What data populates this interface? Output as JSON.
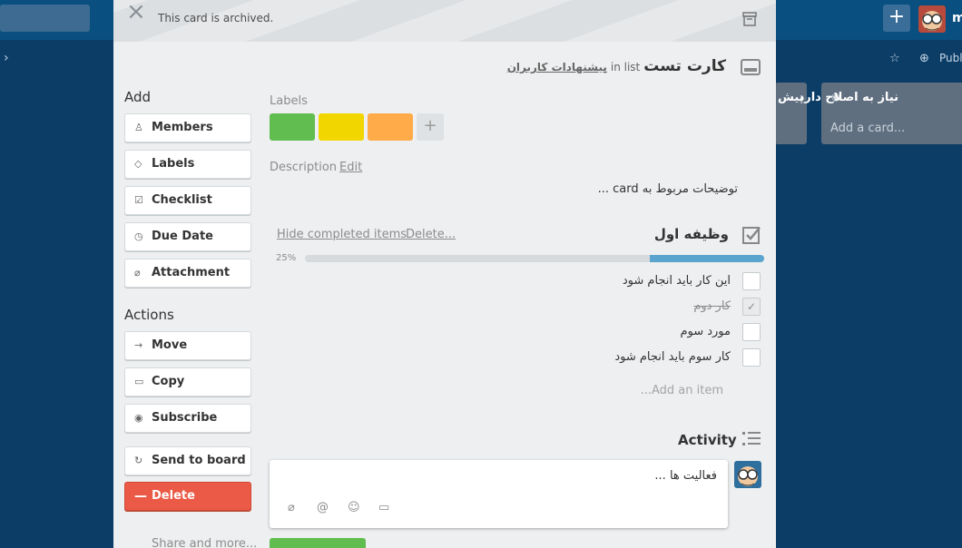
{
  "topbar": {
    "plus_label": "+",
    "user_initial": "m"
  },
  "board": {
    "public_label": "Publ"
  },
  "lists": [
    {
      "title": "پیش"
    },
    {
      "title": "نیاز به اصلاح دارد",
      "add_card": "Add a card..."
    }
  ],
  "archived": {
    "text": "This card is archived."
  },
  "card": {
    "title": "کارت تست",
    "in_list": "in list",
    "list_name": "پیشنهادات کاربران"
  },
  "sidebar": {
    "add_heading": "Add",
    "add_items": [
      {
        "label": "Members",
        "icon": "person-icon"
      },
      {
        "label": "Labels",
        "icon": "tag-icon"
      },
      {
        "label": "Checklist",
        "icon": "checkbox-icon"
      },
      {
        "label": "Due Date",
        "icon": "clock-icon"
      },
      {
        "label": "Attachment",
        "icon": "paperclip-icon"
      }
    ],
    "actions_heading": "Actions",
    "action_items": [
      {
        "label": "Move",
        "icon": "arrow-right-icon"
      },
      {
        "label": "Copy",
        "icon": "card-icon"
      },
      {
        "label": "Subscribe",
        "icon": "eye-icon"
      }
    ],
    "send_to_board": "Send to board",
    "delete": "Delete",
    "share_more": "Share and more..."
  },
  "labels": {
    "heading": "Labels",
    "colors": [
      "#61bd4f",
      "#f2d600",
      "#ffab4a"
    ],
    "add_symbol": "+"
  },
  "description": {
    "heading": "Description",
    "edit": "Edit",
    "text": "توضیحات مربوط به card ..."
  },
  "checklist": {
    "title": "وظیفه اول",
    "hide_completed": "Hide completed items",
    "delete": "Delete...",
    "progress_percent": 25,
    "progress_label": "25%",
    "items": [
      {
        "text": "این کار باید انجام شود",
        "checked": false
      },
      {
        "text": "کار دوم",
        "checked": true
      },
      {
        "text": "مورد سوم",
        "checked": false
      },
      {
        "text": "کار سوم باید انجام شود",
        "checked": false
      }
    ],
    "add_item": "Add an item..."
  },
  "activity": {
    "heading": "Activity",
    "comment_text": "فعالیت ها ..."
  }
}
